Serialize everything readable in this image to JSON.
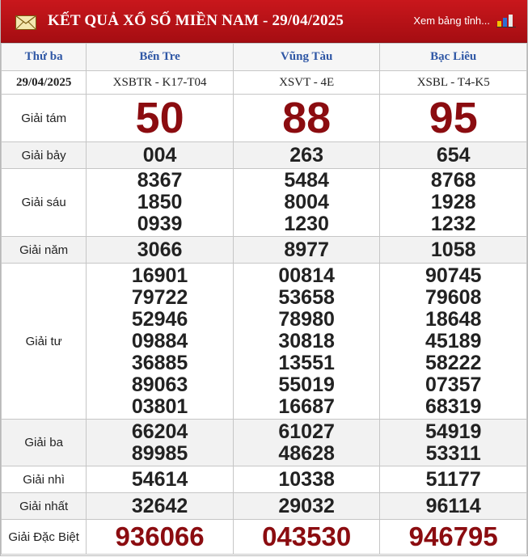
{
  "header": {
    "title": "KẾT QUẢ XỔ SỐ MIỀN NAM - 29/04/2025",
    "more_link": "Xem bảng tỉnh...",
    "mail_icon": "mail-icon",
    "stats_icon": "bar-chart-icon",
    "accent_color": "#b7141a"
  },
  "table": {
    "day": "Thứ ba",
    "date": "29/04/2025",
    "provinces": [
      {
        "name": "Bến Tre",
        "code": "XSBTR - K17-T04"
      },
      {
        "name": "Vũng Tàu",
        "code": "XSVT - 4E"
      },
      {
        "name": "Bạc Liêu",
        "code": "XSBL - T4-K5"
      }
    ],
    "prizes": [
      {
        "label": "Giải tám",
        "results": [
          [
            "50"
          ],
          [
            "88"
          ],
          [
            "95"
          ]
        ]
      },
      {
        "label": "Giải bảy",
        "results": [
          [
            "004"
          ],
          [
            "263"
          ],
          [
            "654"
          ]
        ]
      },
      {
        "label": "Giải sáu",
        "results": [
          [
            "8367",
            "1850",
            "0939"
          ],
          [
            "5484",
            "8004",
            "1230"
          ],
          [
            "8768",
            "1928",
            "1232"
          ]
        ]
      },
      {
        "label": "Giải năm",
        "results": [
          [
            "3066"
          ],
          [
            "8977"
          ],
          [
            "1058"
          ]
        ]
      },
      {
        "label": "Giải tư",
        "results": [
          [
            "16901",
            "79722",
            "52946",
            "09884",
            "36885",
            "89063",
            "03801"
          ],
          [
            "00814",
            "53658",
            "78980",
            "30818",
            "13551",
            "55019",
            "16687"
          ],
          [
            "90745",
            "79608",
            "18648",
            "45189",
            "58222",
            "07357",
            "68319"
          ]
        ]
      },
      {
        "label": "Giải ba",
        "results": [
          [
            "66204",
            "89985"
          ],
          [
            "61027",
            "48628"
          ],
          [
            "54919",
            "53311"
          ]
        ]
      },
      {
        "label": "Giải nhì",
        "results": [
          [
            "54614"
          ],
          [
            "10338"
          ],
          [
            "51177"
          ]
        ]
      },
      {
        "label": "Giải nhất",
        "results": [
          [
            "32642"
          ],
          [
            "29032"
          ],
          [
            "96114"
          ]
        ]
      },
      {
        "label": "Giải Đặc Biệt",
        "results": [
          [
            "936066"
          ],
          [
            "043530"
          ],
          [
            "946795"
          ]
        ]
      }
    ]
  }
}
